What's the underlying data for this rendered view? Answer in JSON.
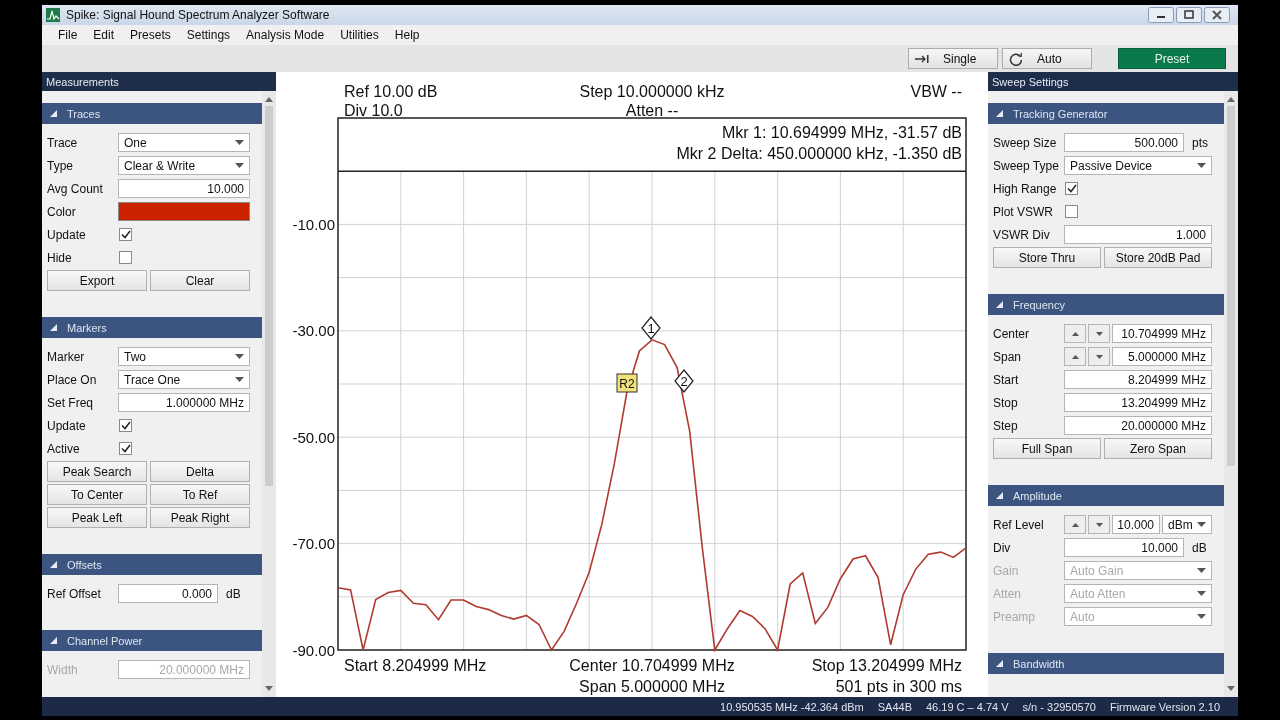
{
  "window": {
    "title": "Spike: Signal Hound Spectrum Analyzer Software"
  },
  "menu": [
    "File",
    "Edit",
    "Presets",
    "Settings",
    "Analysis Mode",
    "Utilities",
    "Help"
  ],
  "toolbar": [
    {
      "label": "Single",
      "kind": "single"
    },
    {
      "label": "Auto",
      "kind": "auto"
    },
    {
      "label": "Preset",
      "kind": "preset"
    }
  ],
  "left_panel": {
    "title": "Measurements",
    "sections": [
      {
        "title": "Traces",
        "rows": [
          {
            "kind": "select",
            "label": "Trace",
            "value": "One",
            "disabled": false
          },
          {
            "kind": "select",
            "label": "Type",
            "value": "Clear & Write",
            "disabled": false
          },
          {
            "kind": "input",
            "label": "Avg Count",
            "value": "10.000",
            "disabled": false
          },
          {
            "kind": "color",
            "label": "Color",
            "color": "#cc2200",
            "disabled": false
          },
          {
            "kind": "check",
            "label": "Update",
            "checked": true,
            "disabled": false
          },
          {
            "kind": "check",
            "label": "Hide",
            "checked": false,
            "disabled": false
          },
          {
            "kind": "buttons",
            "buttons": [
              "Export",
              "Clear"
            ]
          }
        ]
      },
      {
        "title": "Markers",
        "rows": [
          {
            "kind": "select",
            "label": "Marker",
            "value": "Two",
            "disabled": false
          },
          {
            "kind": "select",
            "label": "Place On",
            "value": "Trace One",
            "disabled": false
          },
          {
            "kind": "input",
            "label": "Set Freq",
            "value": "1.000000 MHz",
            "disabled": false
          },
          {
            "kind": "check",
            "label": "Update",
            "checked": true,
            "disabled": false
          },
          {
            "kind": "check",
            "label": "Active",
            "checked": true,
            "disabled": false
          },
          {
            "kind": "buttons",
            "buttons": [
              "Peak Search",
              "Delta"
            ]
          },
          {
            "kind": "buttons",
            "buttons": [
              "To Center",
              "To Ref"
            ]
          },
          {
            "kind": "buttons",
            "buttons": [
              "Peak Left",
              "Peak Right"
            ]
          }
        ]
      },
      {
        "title": "Offsets",
        "rows": [
          {
            "kind": "input",
            "label": "Ref Offset",
            "value": "0.000",
            "unit": "dB",
            "disabled": false
          }
        ]
      },
      {
        "title": "Channel Power",
        "rows": [
          {
            "kind": "input",
            "label": "Width",
            "value": "20.000000 MHz",
            "disabled": true
          }
        ]
      }
    ]
  },
  "plot": {
    "ref": "Ref 10.00 dB",
    "div": "Div 10.0",
    "step": "Step 10.000000 kHz",
    "atten": "Atten --",
    "vbw": "VBW --",
    "readouts": [
      "Mkr 1: 10.694999 MHz, -31.57 dB",
      "Mkr 2 Delta: 450.000000 kHz, -1.350 dB"
    ],
    "start": "Start 8.204999 MHz",
    "center": "Center 10.704999 MHz",
    "span": "Span 5.000000 MHz",
    "stop": "Stop 13.204999 MHz",
    "points": "501 pts in 300 ms",
    "markers": [
      {
        "label": "1",
        "kind": "marker"
      },
      {
        "label": "R2",
        "kind": "reference"
      },
      {
        "label": "2",
        "kind": "marker"
      }
    ],
    "chart_data": {
      "type": "line",
      "grid": true,
      "ylim": [
        -90,
        10
      ],
      "yticks": [
        {
          "value": -10,
          "label": "-10.00"
        },
        {
          "value": -30,
          "label": "-30.00"
        },
        {
          "value": -50,
          "label": "-50.00"
        },
        {
          "value": -70,
          "label": "-70.00"
        },
        {
          "value": -90,
          "label": "-90.00"
        }
      ],
      "categories": [
        null,
        null,
        null,
        null,
        null,
        null,
        null,
        null,
        null,
        null,
        null,
        null,
        null,
        null,
        null,
        null,
        null,
        null,
        null,
        null,
        null,
        null,
        null,
        null,
        null,
        null,
        null,
        null,
        null,
        null,
        null,
        null,
        null,
        null,
        null,
        null,
        null,
        null,
        null,
        null,
        null,
        null,
        null,
        null,
        null,
        null,
        null,
        null,
        null,
        null,
        null
      ],
      "series": [
        {
          "color": "#b03a2e",
          "values": [
            -78.3,
            -78.7,
            -90,
            -80.5,
            -79.2,
            -78.8,
            -81.2,
            -81.5,
            -84.3,
            -80.6,
            -80.6,
            -81.8,
            -82.4,
            -83.5,
            -84.2,
            -83.5,
            -85.2,
            -90,
            -86.5,
            -81.2,
            -75.4,
            -66.4,
            -55.0,
            -41.5,
            -33.8,
            -31.7,
            -32.6,
            -36.9,
            -48.9,
            -70.6,
            -90,
            -86.0,
            -82.6,
            -83.7,
            -86.0,
            -90,
            -77.6,
            -75.5,
            -85.0,
            -82.0,
            -76.6,
            -72.9,
            -72.3,
            -76.4,
            -89.0,
            -79.6,
            -74.8,
            -72.0,
            -71.6,
            -72.6,
            -70.8
          ]
        }
      ]
    }
  },
  "right_panel": {
    "title": "Sweep Settings",
    "sections": [
      {
        "title": "Tracking Generator",
        "rows": [
          {
            "kind": "input",
            "label": "Sweep Size",
            "value": "500.000",
            "unit": "pts",
            "disabled": false
          },
          {
            "kind": "select",
            "label": "Sweep Type",
            "value": "Passive Device",
            "disabled": false
          },
          {
            "kind": "check",
            "label": "High Range",
            "checked": true,
            "disabled": false
          },
          {
            "kind": "check",
            "label": "Plot VSWR",
            "checked": false,
            "disabled": false
          },
          {
            "kind": "input",
            "label": "VSWR Div",
            "value": "1.000",
            "disabled": false
          },
          {
            "kind": "buttons",
            "buttons": [
              "Store Thru",
              "Store 20dB Pad"
            ]
          }
        ]
      },
      {
        "title": "Frequency",
        "rows": [
          {
            "kind": "stepper",
            "label": "Center",
            "value": "10.704999 MHz",
            "disabled": false
          },
          {
            "kind": "stepper",
            "label": "Span",
            "value": "5.000000 MHz",
            "disabled": false
          },
          {
            "kind": "input",
            "label": "Start",
            "value": "8.204999 MHz",
            "disabled": false
          },
          {
            "kind": "input",
            "label": "Stop",
            "value": "13.204999 MHz",
            "disabled": false
          },
          {
            "kind": "input",
            "label": "Step",
            "value": "20.000000 MHz",
            "disabled": false
          },
          {
            "kind": "buttons",
            "buttons": [
              "Full Span",
              "Zero Span"
            ]
          }
        ]
      },
      {
        "title": "Amplitude",
        "rows": [
          {
            "kind": "stepper",
            "label": "Ref Level",
            "value": "10.000",
            "unit_select": "dBm",
            "disabled": false
          },
          {
            "kind": "input",
            "label": "Div",
            "value": "10.000",
            "unit": "dB",
            "disabled": false
          },
          {
            "kind": "select",
            "label": "Gain",
            "value": "Auto Gain",
            "disabled": true
          },
          {
            "kind": "select",
            "label": "Atten",
            "value": "Auto Atten",
            "disabled": true
          },
          {
            "kind": "select",
            "label": "Preamp",
            "value": "Auto",
            "disabled": true
          }
        ]
      },
      {
        "title": "Bandwidth"
      }
    ]
  },
  "status_bar": [
    "10.950535 MHz -42.364 dBm",
    "SA44B",
    "46.19 C – 4.74 V",
    "s/n - 32950570",
    "Firmware Version 2.10"
  ]
}
